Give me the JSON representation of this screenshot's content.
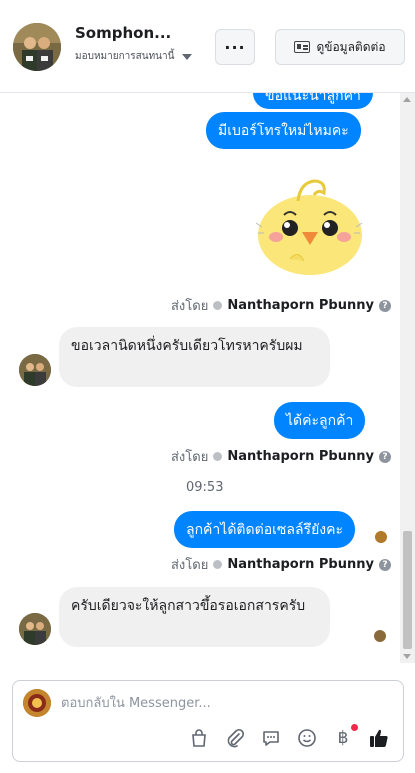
{
  "header": {
    "name": "Somphon...",
    "assign_label": "มอบหมายการสนทนานี้",
    "more_label": "···",
    "contact_label": "ดูข้อมูลติดต่อ"
  },
  "thread": {
    "messages": [
      {
        "type": "outgoing",
        "text": "มีเบอร์โทรใหม่ไหมคะ"
      },
      {
        "type": "sticker",
        "description": "yellow chick sticker"
      },
      {
        "type": "sent_by",
        "prefix": "ส่งโดย",
        "name": "Nanthaporn Pbunny"
      },
      {
        "type": "incoming",
        "text": "ขอเวลานิดหนึ่งครับเดียวโทรหาครับผม"
      },
      {
        "type": "outgoing",
        "text": "ได้ค่ะลูกค้า"
      },
      {
        "type": "sent_by",
        "prefix": "ส่งโดย",
        "name": "Nanthaporn Pbunny"
      },
      {
        "type": "timestamp",
        "text": "09:53"
      },
      {
        "type": "outgoing",
        "text": "ลูกค้าได้ติดต่อเซลล์รึยังคะ"
      },
      {
        "type": "sent_by",
        "prefix": "ส่งโดย",
        "name": "Nanthaporn Pbunny"
      },
      {
        "type": "incoming",
        "text": "ครับเดียวจะให้ลูกสาวขึ้อรอเอกสารครับ"
      }
    ],
    "partial_top_text": "ขอแนะนำลูกค้า"
  },
  "composer": {
    "placeholder": "ตอบกลับใน Messenger...",
    "tools": [
      "bag-icon",
      "paperclip-icon",
      "speech-bubble-icon",
      "emoji-icon",
      "baht-icon",
      "thumbs-up-icon"
    ],
    "baht_symbol": "฿"
  },
  "colors": {
    "brand_blue": "#0084ff",
    "incoming_bubble": "#f1f0f0",
    "notification_red": "#f02849"
  }
}
